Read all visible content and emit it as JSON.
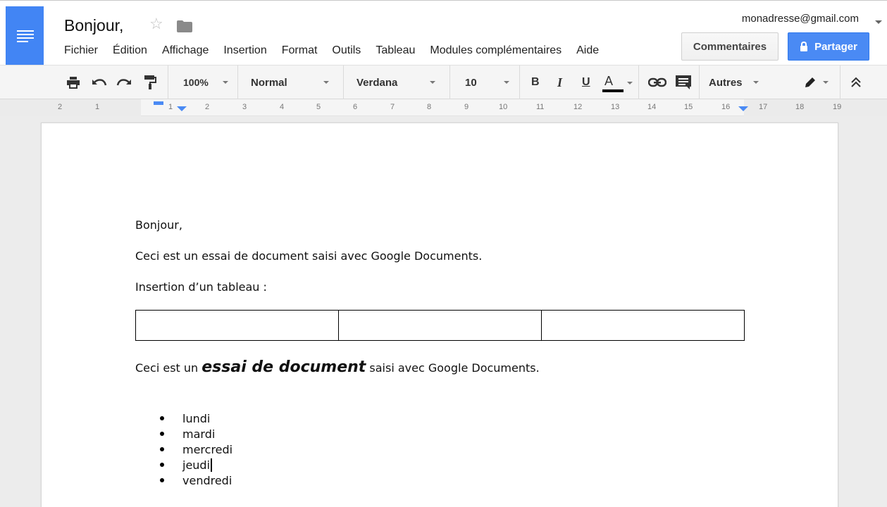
{
  "header": {
    "doc_title": "Bonjour,",
    "account_email": "monadresse@gmail.com",
    "comments_label": "Commentaires",
    "share_label": "Partager"
  },
  "menu": [
    "Fichier",
    "Édition",
    "Affichage",
    "Insertion",
    "Format",
    "Outils",
    "Tableau",
    "Modules complémentaires",
    "Aide"
  ],
  "toolbar": {
    "zoom": "100%",
    "style": "Normal",
    "font": "Verdana",
    "size": "10",
    "bold": "B",
    "italic": "I",
    "underline": "U",
    "text_color": "A",
    "more": "Autres",
    "text_color_value": "#000000"
  },
  "ruler": {
    "labels": [
      "2",
      "1",
      "1",
      "2",
      "3",
      "4",
      "5",
      "6",
      "7",
      "8",
      "9",
      "10",
      "11",
      "12",
      "13",
      "14",
      "15",
      "16",
      "17",
      "18",
      "19"
    ]
  },
  "document": {
    "line1": "Bonjour,",
    "line2": "Ceci est un essai de document saisi avec Google Documents.",
    "line3": "Insertion d’un tableau :",
    "line4_before": "Ceci est un ",
    "line4_emphasis": "essai de document",
    "line4_after": " saisi avec Google Documents.",
    "list": [
      "lundi",
      "mardi",
      "mercredi",
      "jeudi",
      "vendredi"
    ]
  },
  "colors": {
    "brand_blue": "#4285f4",
    "share_blue": "#4a8af4"
  }
}
